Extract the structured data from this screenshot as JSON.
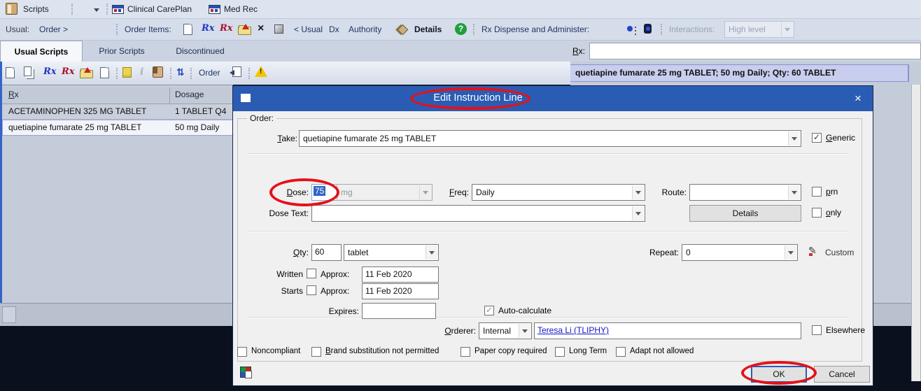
{
  "icons": {
    "close_glyph": "×",
    "help_glyph": "?",
    "info_glyph": "i",
    "delete_glyph": "×",
    "refresh_glyph": "⇅",
    "pen_glyph": "✎",
    "rx_glyph": "Rx"
  },
  "colors": {
    "title_bar_blue": "#2b5cb4",
    "annotation_red": "#e31219",
    "selection_blue": "#3163c5",
    "summary_highlight": "#c9cdee",
    "panel_gray_blue": "#c5ccd9",
    "dark_band": "#0a101e",
    "link_blue": "#1414cc"
  },
  "titlebar": {
    "scripts": "Scripts",
    "clinical_careplan": "Clinical CarePlan",
    "med_rec": "Med Rec"
  },
  "ribbon": {
    "usual": "Usual:",
    "order": "Order >",
    "order_items": "Order Items:",
    "usual_link": "< Usual",
    "dx": "Dx",
    "authority": "Authority",
    "details": "Details",
    "rx_dispense": "Rx Dispense and Administer:",
    "interactions": "Interactions:",
    "interactions_value": "High level"
  },
  "tabs": {
    "usual": "Usual Scripts",
    "prior": "Prior Scripts",
    "discontinued": "Discontinued"
  },
  "rx_bar": {
    "label": "Rx:",
    "value": "",
    "summary": "quetiapine fumarate 25 mg TABLET; 50 mg Daily; Qty: 60 TABLET"
  },
  "list_toolbar": {
    "order": "Order"
  },
  "table": {
    "headers": [
      "Rx",
      "Dosage"
    ],
    "rows": [
      {
        "rx": "ACETAMINOPHEN 325 MG TABLET",
        "dosage": "1 TABLET Q4"
      },
      {
        "rx": "quetiapine fumarate 25 mg TABLET",
        "dosage": "50 mg Daily"
      }
    ]
  },
  "dialog": {
    "title": "Edit Instruction Line",
    "group": "Order:",
    "take_label": "Take:",
    "take_value": "quetiapine fumarate 25 mg TABLET",
    "generic_label": "Generic",
    "generic_checked": true,
    "dose_label": "Dose:",
    "dose_value": "75",
    "dose_unit": "mg",
    "freq_label": "Freq:",
    "freq_value": "Daily",
    "route_label": "Route:",
    "route_value": "",
    "prn_label": "prn",
    "prn_checked": false,
    "dose_text_label": "Dose Text:",
    "dose_text_value": "",
    "details_button": "Details",
    "only_label": "only",
    "only_checked": false,
    "qty_label": "Qty:",
    "qty_value": "60",
    "qty_unit": "tablet",
    "repeat_label": "Repeat:",
    "repeat_value": "0",
    "custom_label": "Custom",
    "written_label": "Written",
    "written_checked": false,
    "written_approx_label": "Approx:",
    "written_date": "11 Feb 2020",
    "starts_label": "Starts",
    "starts_checked": false,
    "starts_approx_label": "Approx:",
    "starts_date": "11 Feb 2020",
    "expires_label": "Expires:",
    "expires_value": "",
    "autocalc_label": "Auto-calculate",
    "autocalc_checked": true,
    "orderer_label": "Orderer:",
    "orderer_type": "Internal",
    "orderer_name": "Teresa Li (TLIPHY)",
    "elsewhere_label": "Elsewhere",
    "elsewhere_checked": false,
    "flags": [
      {
        "label": "Noncompliant",
        "checked": false
      },
      {
        "label": "Brand substitution not permitted",
        "checked": false
      },
      {
        "label": "Paper copy required",
        "checked": false
      },
      {
        "label": "Long Term",
        "checked": false
      },
      {
        "label": "Adapt not allowed",
        "checked": false
      }
    ],
    "ok": "OK",
    "cancel": "Cancel"
  }
}
